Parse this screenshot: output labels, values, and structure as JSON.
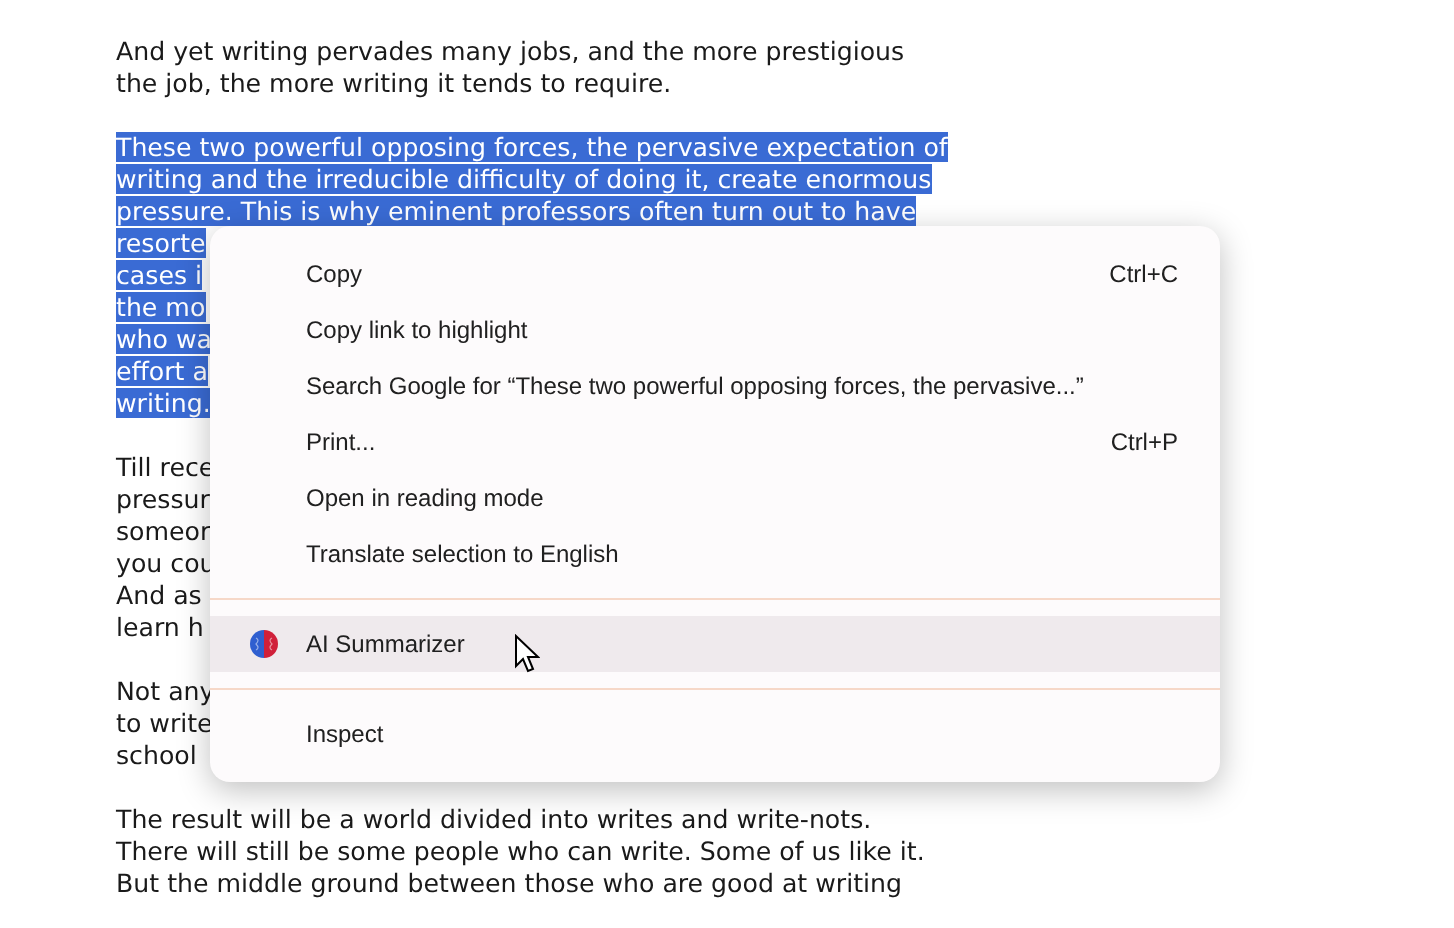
{
  "paragraphs": [
    {
      "selected": false,
      "lines": [
        "And yet writing pervades many jobs, and the more prestigious",
        "the job, the more writing it tends to require."
      ]
    },
    {
      "selected": true,
      "lines": [
        "These two powerful opposing forces, the pervasive expectation of",
        "writing and the irreducible difficulty of doing it, create enormous",
        "pressure. This is why eminent professors often turn out to have",
        "resorte",
        "cases i",
        "the mo",
        "who wa",
        "effort a",
        "writing."
      ]
    },
    {
      "selected": false,
      "lines": [
        "Till rece",
        "pressur",
        "someor",
        "you cou",
        "And as",
        "learn h"
      ]
    },
    {
      "selected": false,
      "lines": [
        "Not any",
        "to write",
        "school"
      ]
    },
    {
      "selected": false,
      "lines": [
        "The result will be a world divided into writes and write-nots.",
        "There will still be some people who can write. Some of us like it.",
        "But the middle ground between those who are good at writing"
      ]
    }
  ],
  "context_menu": {
    "items": [
      {
        "kind": "item",
        "label": "Copy",
        "shortcut": "Ctrl+C",
        "hovered": false
      },
      {
        "kind": "item",
        "label": "Copy link to highlight",
        "hovered": false
      },
      {
        "kind": "item",
        "label": "Search Google for “These two powerful opposing forces, the pervasive...”",
        "hovered": false
      },
      {
        "kind": "item",
        "label": "Print...",
        "shortcut": "Ctrl+P",
        "hovered": false
      },
      {
        "kind": "item",
        "label": "Open in reading mode",
        "hovered": false
      },
      {
        "kind": "item",
        "label": "Translate selection to English",
        "hovered": false
      },
      {
        "kind": "separator"
      },
      {
        "kind": "extension",
        "label": "AI Summarizer",
        "hovered": true
      },
      {
        "kind": "separator"
      },
      {
        "kind": "item",
        "label": "Inspect",
        "hovered": false
      }
    ]
  }
}
